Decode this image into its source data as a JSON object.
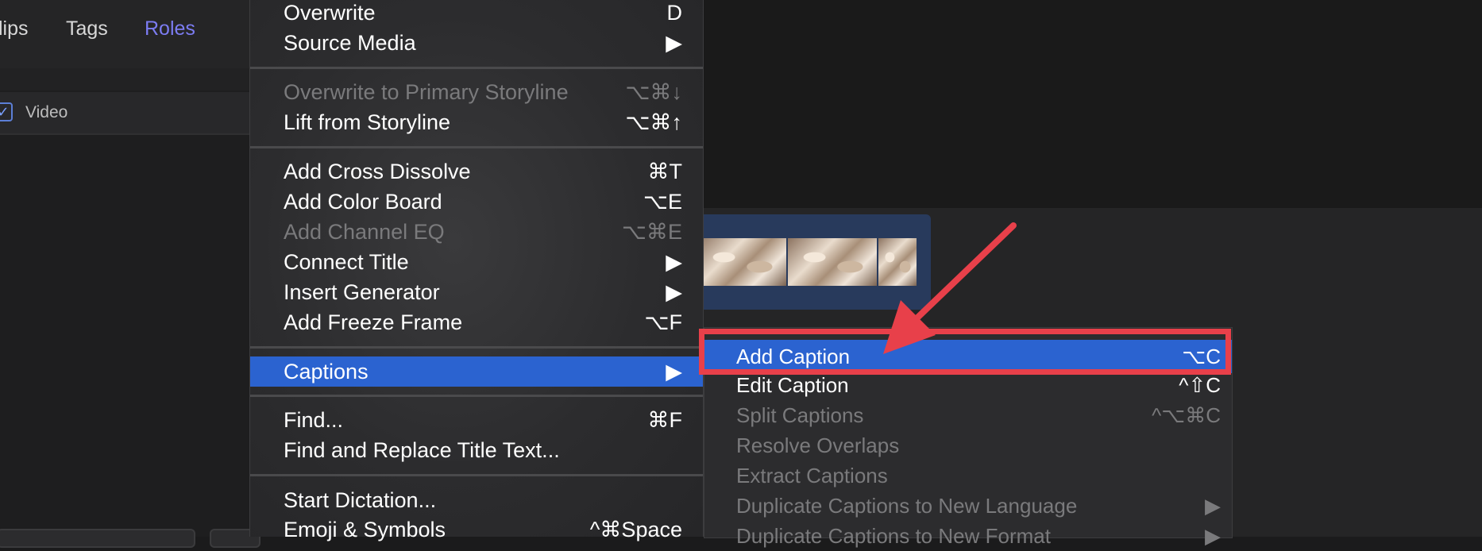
{
  "left_panel": {
    "tabs": [
      {
        "label": "lips",
        "active": false
      },
      {
        "label": "Tags",
        "active": false
      },
      {
        "label": "Roles",
        "active": true
      }
    ],
    "roles": [
      {
        "label": "Video",
        "checked": true
      }
    ]
  },
  "menu": {
    "items": [
      {
        "label": "Overwrite",
        "shortcut": "D",
        "disabled": false
      },
      {
        "label": "Source Media",
        "shortcut": "▶",
        "disabled": false
      },
      {
        "label": "Overwrite to Primary Storyline",
        "shortcut": "⌥⌘↓",
        "disabled": true
      },
      {
        "label": "Lift from Storyline",
        "shortcut": "⌥⌘↑",
        "disabled": false
      },
      {
        "label": "Add Cross Dissolve",
        "shortcut": "⌘T",
        "disabled": false
      },
      {
        "label": "Add Color Board",
        "shortcut": "⌥E",
        "disabled": false
      },
      {
        "label": "Add Channel EQ",
        "shortcut": "⌥⌘E",
        "disabled": true
      },
      {
        "label": "Connect Title",
        "shortcut": "▶",
        "disabled": false
      },
      {
        "label": "Insert Generator",
        "shortcut": "▶",
        "disabled": false
      },
      {
        "label": "Add Freeze Frame",
        "shortcut": "⌥F",
        "disabled": false
      },
      {
        "label": "Captions",
        "shortcut": "▶",
        "disabled": false,
        "highlighted": true
      },
      {
        "label": "Find...",
        "shortcut": "⌘F",
        "disabled": false
      },
      {
        "label": "Find and Replace Title Text...",
        "shortcut": "",
        "disabled": false
      },
      {
        "label": "Start Dictation...",
        "shortcut": "",
        "disabled": false
      },
      {
        "label": "Emoji & Symbols",
        "shortcut": "^⌘Space",
        "disabled": false
      }
    ]
  },
  "submenu": {
    "items": [
      {
        "label": "Add Caption",
        "shortcut": "⌥C",
        "disabled": false,
        "highlighted": true
      },
      {
        "label": "Edit Caption",
        "shortcut": "^⇧C",
        "disabled": false
      },
      {
        "label": "Split Captions",
        "shortcut": "^⌥⌘C",
        "disabled": true
      },
      {
        "label": "Resolve Overlaps",
        "shortcut": "",
        "disabled": true
      },
      {
        "label": "Extract Captions",
        "shortcut": "",
        "disabled": true
      },
      {
        "label": "Duplicate Captions to New Language",
        "shortcut": "▶",
        "disabled": true
      },
      {
        "label": "Duplicate Captions to New Format",
        "shortcut": "▶",
        "disabled": true
      }
    ]
  },
  "colors": {
    "highlight": "#2b63d0",
    "annotation": "#e8404a",
    "accent_tab": "#7c7cf2"
  }
}
